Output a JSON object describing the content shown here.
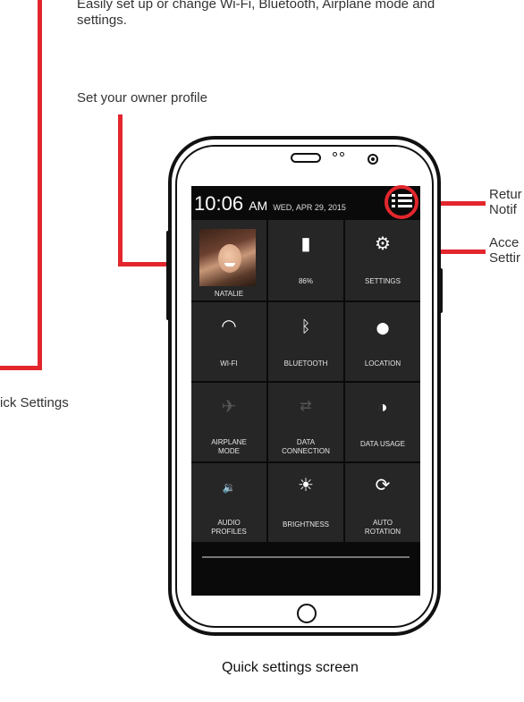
{
  "annotations": {
    "top_text_line1": "Easily set up or change Wi-Fi, Bluetooth, Airplane mode and",
    "top_text_line2": "settings.",
    "owner_profile": "Set your owner profile",
    "quick_settings_left": "ick Settings",
    "return_line1": "Retur",
    "return_line2": "Notif",
    "access_line1": "Acce",
    "access_line2": "Settir",
    "caption": "Quick settings screen"
  },
  "status_bar": {
    "time": "10:06",
    "ampm": "AM",
    "date": "WED, APR 29, 2015"
  },
  "tiles": [
    {
      "label": "NATALIE",
      "icon": "profile-photo"
    },
    {
      "label": "86%",
      "icon": "battery-icon",
      "glyph": "▮"
    },
    {
      "label": "SETTINGS",
      "icon": "gear-icon",
      "glyph": "⚙"
    },
    {
      "label": "WI-FI",
      "icon": "wifi-icon",
      "glyph": "◠"
    },
    {
      "label": "BLUETOOTH",
      "icon": "bluetooth-icon",
      "glyph": "ᛒ"
    },
    {
      "label": "LOCATION",
      "icon": "location-pin-icon",
      "glyph": "⬤"
    },
    {
      "label": "AIRPLANE\nMODE",
      "icon": "airplane-icon",
      "glyph": "✈"
    },
    {
      "label": "DATA\nCONNECTION",
      "icon": "data-connection-icon",
      "glyph": "⇄"
    },
    {
      "label": "DATA USAGE",
      "icon": "data-usage-icon",
      "glyph": "◑"
    },
    {
      "label": "AUDIO\nPROFILES",
      "icon": "audio-profiles-icon",
      "glyph": "🔉"
    },
    {
      "label": "BRIGHTNESS",
      "icon": "brightness-icon",
      "glyph": "☀"
    },
    {
      "label": "AUTO\nROTATION",
      "icon": "auto-rotation-icon",
      "glyph": "⟳"
    }
  ],
  "colors": {
    "callout": "#e3262d",
    "tile_bg": "#262626",
    "screen_bg": "#0a0a0a"
  }
}
